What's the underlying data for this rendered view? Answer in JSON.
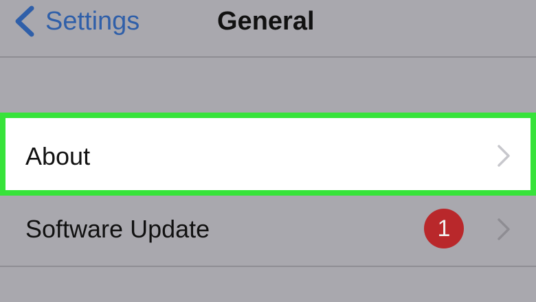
{
  "navbar": {
    "back_label": "Settings",
    "title": "General"
  },
  "rows": [
    {
      "label": "About"
    },
    {
      "label": "Software Update",
      "badge": "1"
    }
  ],
  "colors": {
    "background": "#a9a8ae",
    "link_blue": "#2f5fa9",
    "highlight_green": "#37e33a",
    "badge_red": "#b9282b"
  },
  "icons": {
    "back": "chevron-left-icon",
    "disclosure": "chevron-right-icon"
  }
}
